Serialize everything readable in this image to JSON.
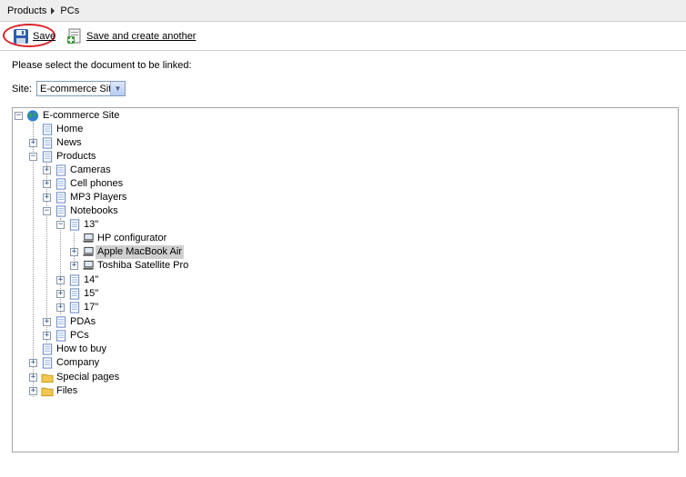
{
  "breadcrumb": {
    "items": [
      "Products",
      "PCs"
    ]
  },
  "toolbar": {
    "save_label": "Save",
    "save_another_label": "Save and create another"
  },
  "intro_text": "Please select the document to be linked:",
  "site_selector": {
    "label": "Site:",
    "value": "E-commerce Site"
  },
  "tree": {
    "root": "E-commerce Site",
    "home": "Home",
    "news": "News",
    "products": "Products",
    "cameras": "Cameras",
    "cell_phones": "Cell phones",
    "mp3_players": "MP3 Players",
    "notebooks": "Notebooks",
    "n13": "13\"",
    "hp_configurator": "HP configurator",
    "apple_macbook_air": "Apple MacBook Air",
    "toshiba": "Toshiba Satellite Pro",
    "n14": "14\"",
    "n15": "15\"",
    "n17": "17\"",
    "pdas": "PDAs",
    "pcs": "PCs",
    "how_to_buy": "How to buy",
    "company": "Company",
    "special_pages": "Special pages",
    "files": "Files"
  },
  "colors": {
    "highlight_ring": "#d9262b",
    "selected_bg": "#cfcfcf",
    "border": "#a7a7a7"
  }
}
